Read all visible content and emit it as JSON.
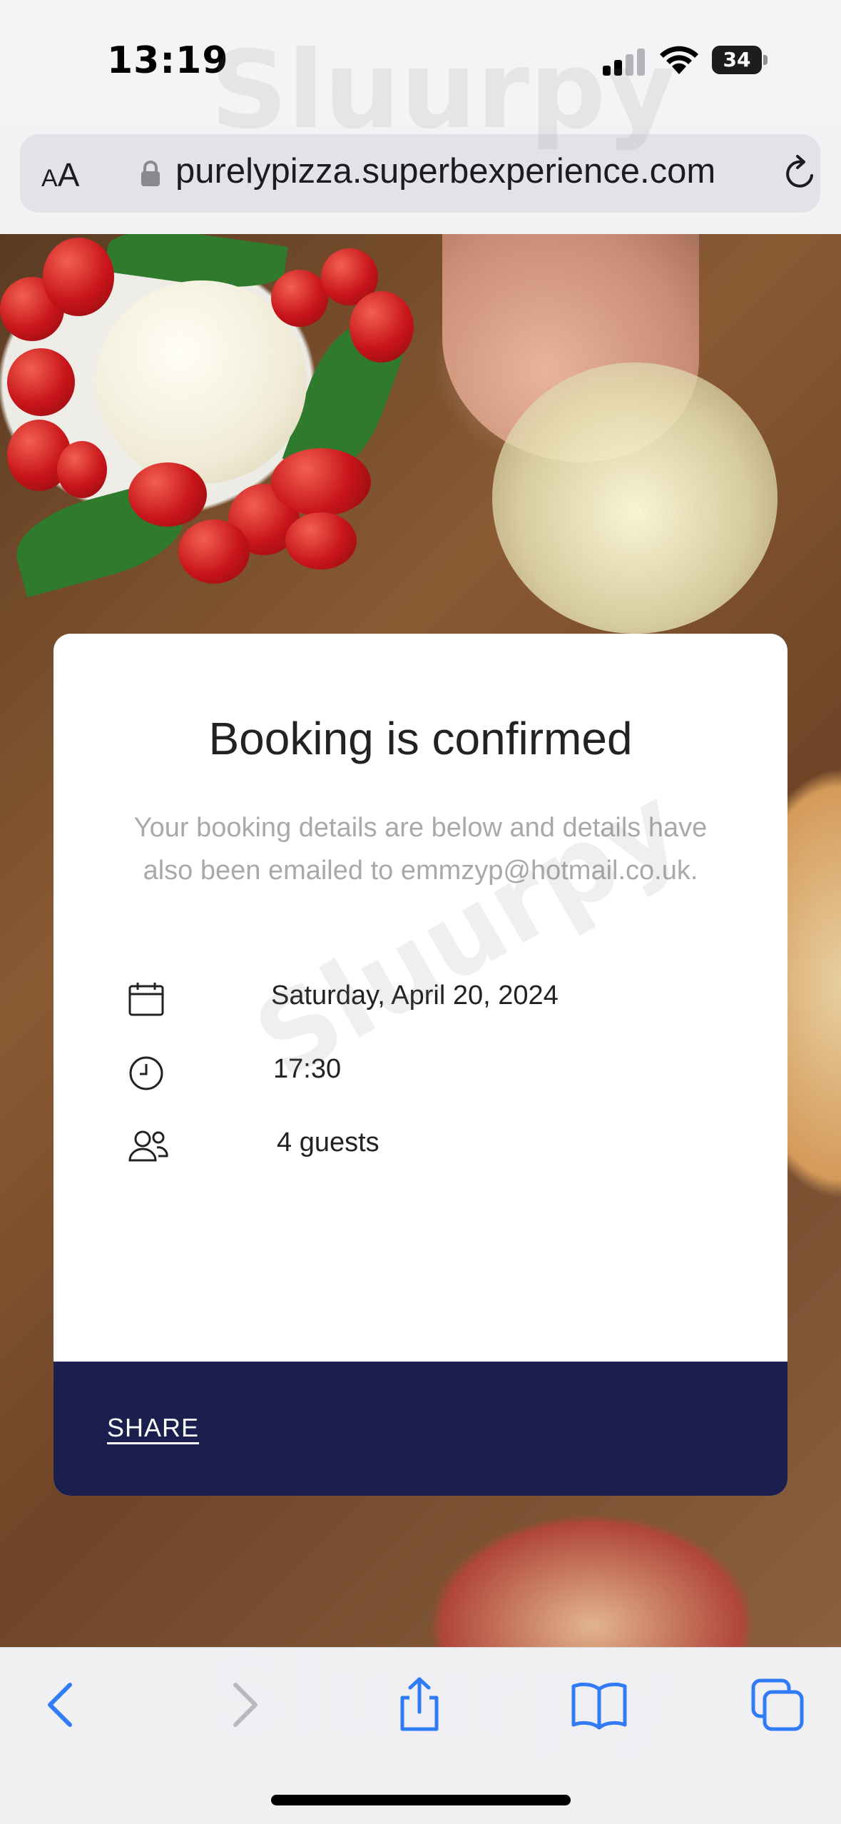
{
  "status_bar": {
    "time": "13:19",
    "battery_level": "34"
  },
  "browser": {
    "text_size_label_small": "A",
    "text_size_label_big": "A",
    "url": "purelypizza.superbexperience.com"
  },
  "booking": {
    "title": "Booking is confirmed",
    "description": "Your booking details are below and details have also been emailed to emmzyp@hotmail.co.uk.",
    "date": "Saturday, April 20, 2024",
    "time": "17:30",
    "guests": "4 guests",
    "share_label": "SHARE",
    "footer_color": "#1b1f4d"
  },
  "toolbar": {
    "icons": [
      "back-icon",
      "forward-icon",
      "share-icon",
      "bookmarks-icon",
      "tabs-icon"
    ],
    "accent": "#2f7cf6"
  },
  "watermark": "Sluurpy"
}
